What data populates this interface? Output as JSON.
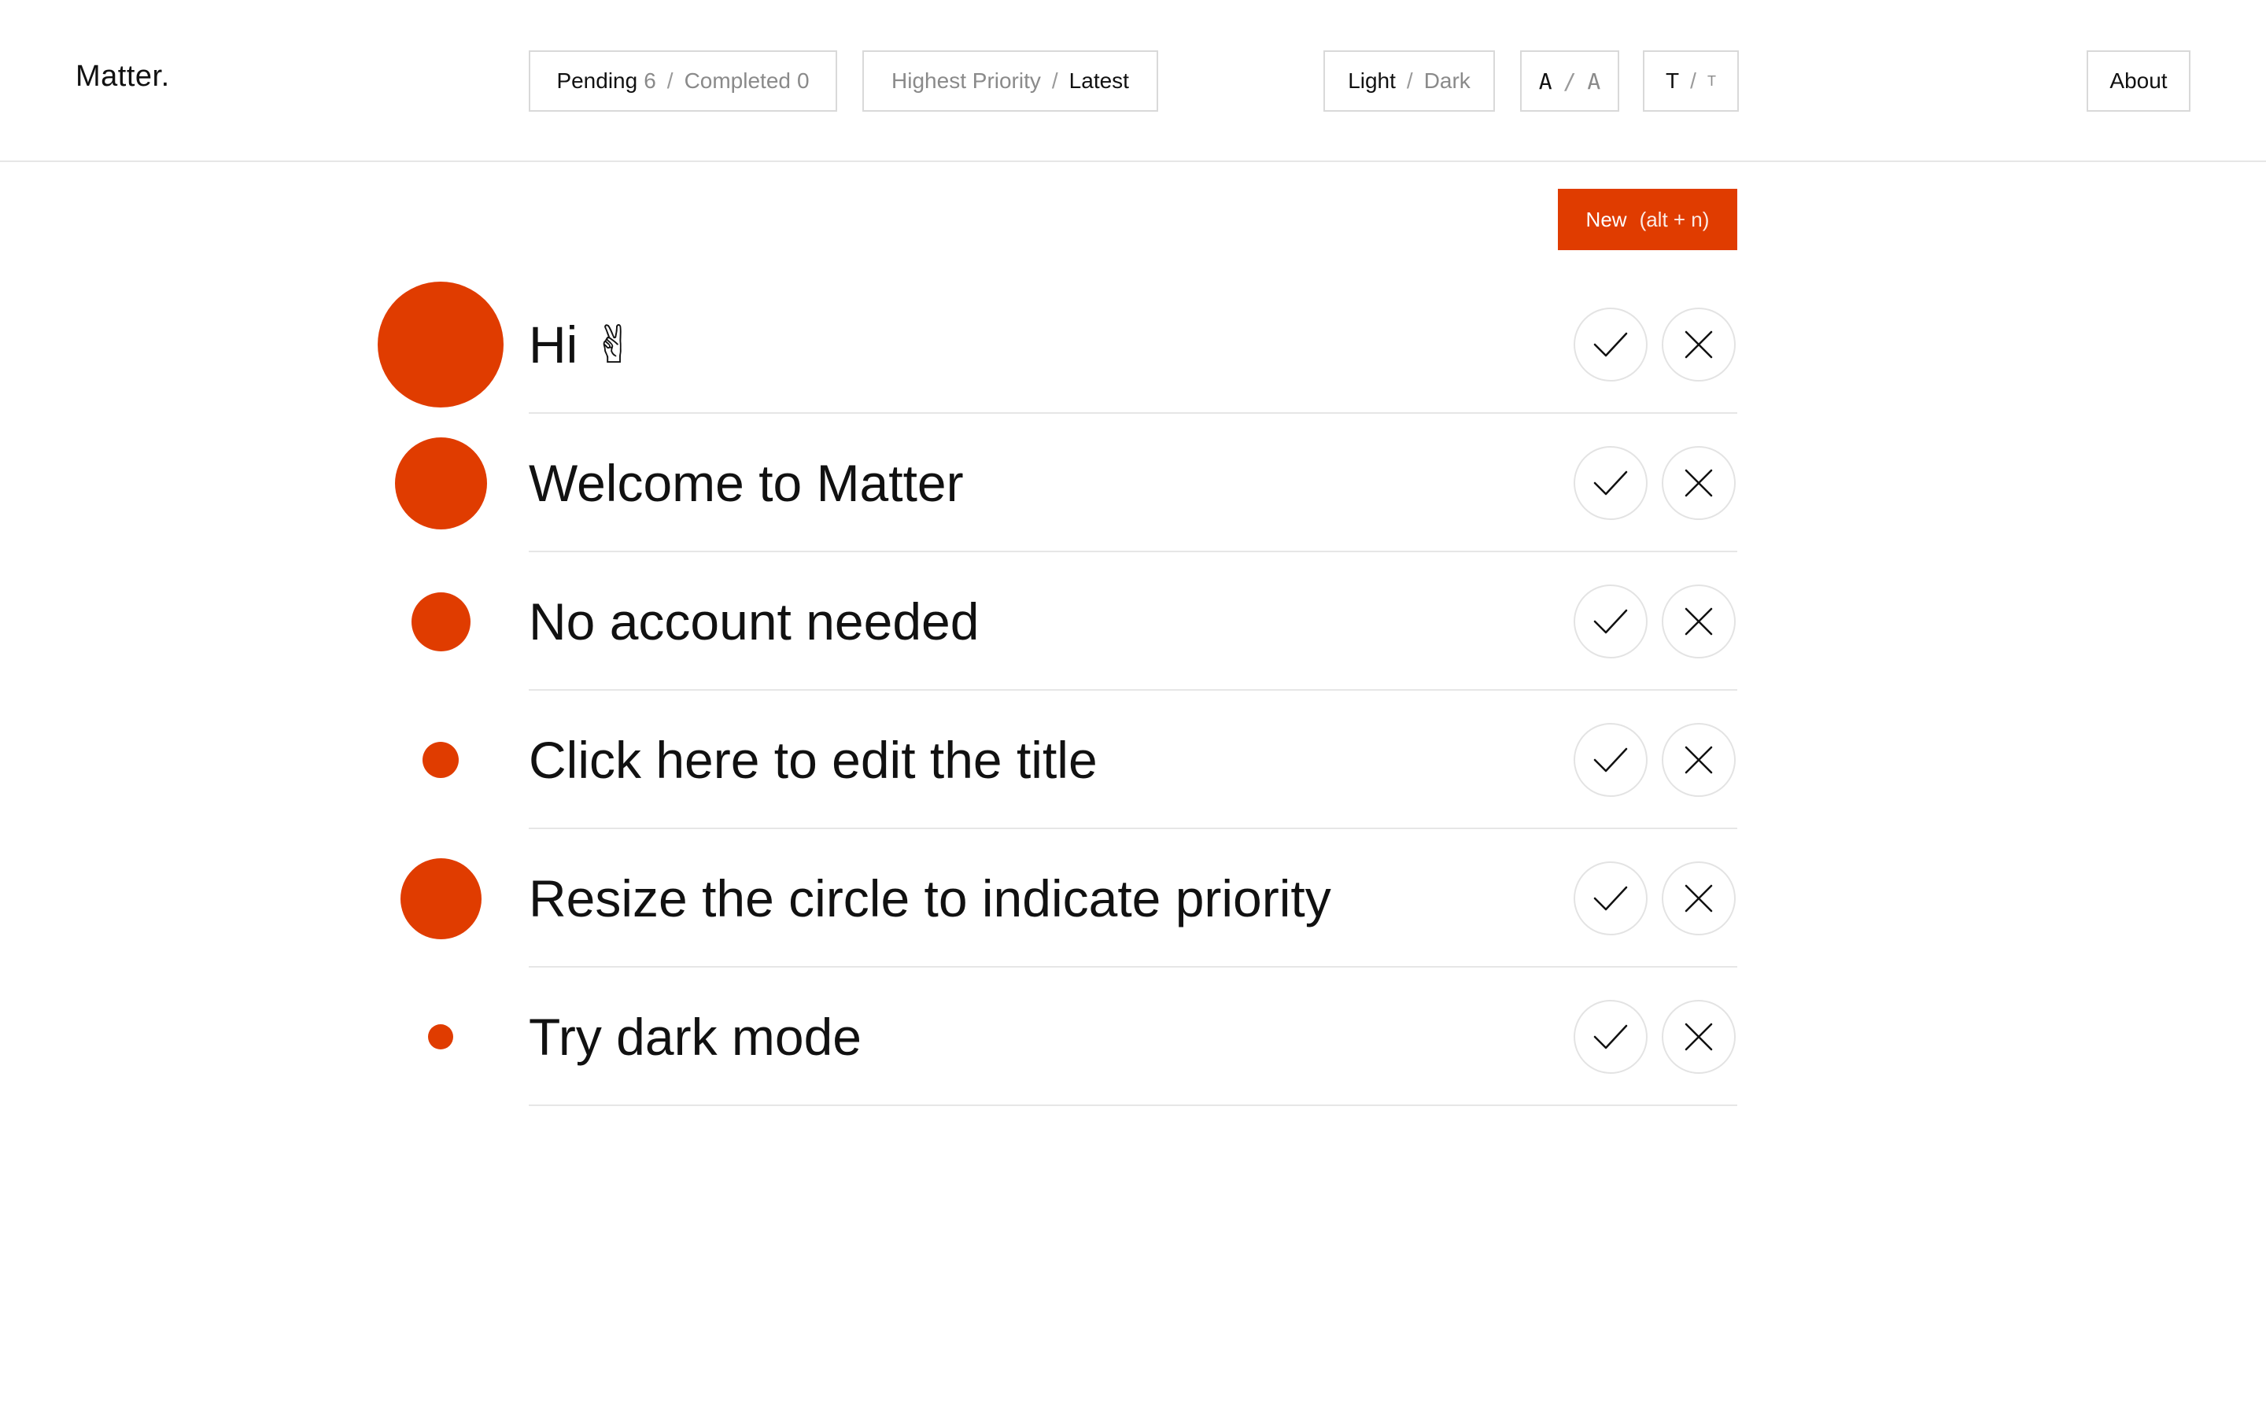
{
  "app": {
    "logo": "Matter."
  },
  "header": {
    "filter": {
      "pending_label": "Pending",
      "pending_count": "6",
      "separator": "/",
      "completed_label": "Completed",
      "completed_count": "0"
    },
    "sort": {
      "highest_label": "Highest Priority",
      "separator": "/",
      "latest_label": "Latest"
    },
    "theme": {
      "light_label": "Light",
      "separator": "/",
      "dark_label": "Dark"
    },
    "font": {
      "a_mono": "A",
      "separator": "/",
      "a_alt": "A"
    },
    "size": {
      "large": "T",
      "separator": "/",
      "small": "T"
    },
    "about_label": "About"
  },
  "new_button": {
    "label": "New",
    "shortcut": "(alt + n)"
  },
  "colors": {
    "accent": "#e03c00",
    "text": "#111111",
    "muted": "#8a8a8a",
    "divider": "#e6e6e6"
  },
  "tasks": [
    {
      "title": "Hi ✌",
      "priority": 1.0
    },
    {
      "title": "Welcome to Matter",
      "priority": 0.7
    },
    {
      "title": "No account needed",
      "priority": 0.4
    },
    {
      "title": "Click here to edit the title",
      "priority": 0.2
    },
    {
      "title": "Resize the circle to indicate priority",
      "priority": 0.6
    },
    {
      "title": "Try dark mode",
      "priority": 0.1
    }
  ],
  "icons": {
    "complete": "check-icon",
    "delete": "close-icon"
  }
}
